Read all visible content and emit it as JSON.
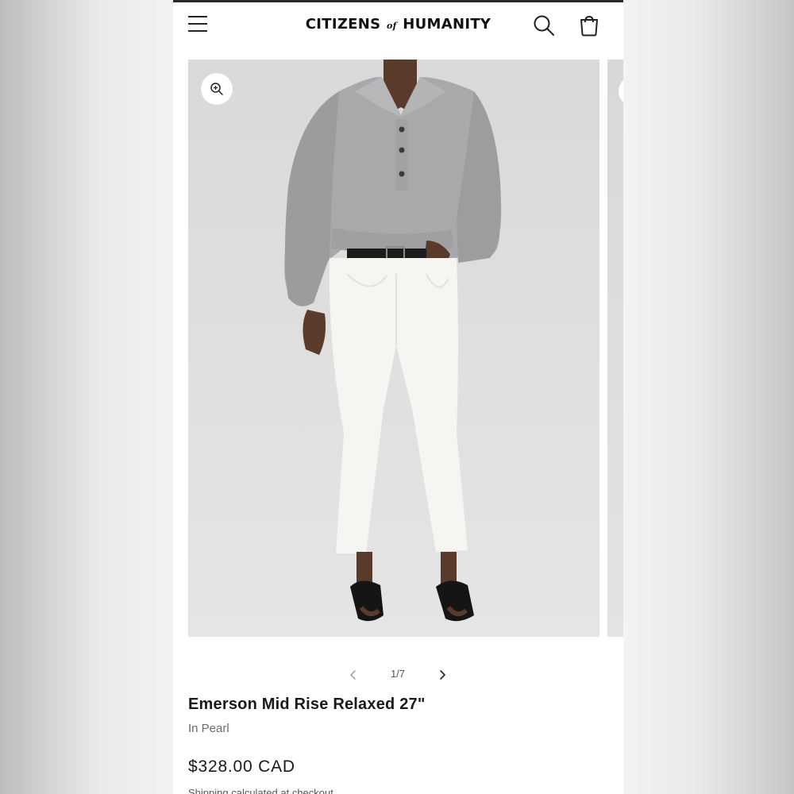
{
  "header": {
    "menu_icon": "hamburger-menu-icon",
    "logo_part1": "CITIZENS",
    "logo_of": "of",
    "logo_part2": "HUMANITY",
    "search_icon": "search-icon",
    "cart_icon": "cart-icon"
  },
  "gallery": {
    "zoom_icon": "zoom-in-icon",
    "image_desc": "model-wearing-gray-sweatshirt-white-jeans",
    "counter": "1/7",
    "prev_icon": "chevron-left-icon",
    "next_icon": "chevron-right-icon"
  },
  "product": {
    "title": "Emerson Mid Rise Relaxed 27\"",
    "color": "In Pearl",
    "price": "$328.00 CAD",
    "shipping_text": "Shipping calculated at checkout"
  },
  "colors": {
    "text_primary": "#1a1a1a",
    "text_muted": "#6b6b6b",
    "image_background": "#e0e0e0",
    "sweatshirt": "#a9a9ab",
    "jeans": "#f6f5f2"
  }
}
